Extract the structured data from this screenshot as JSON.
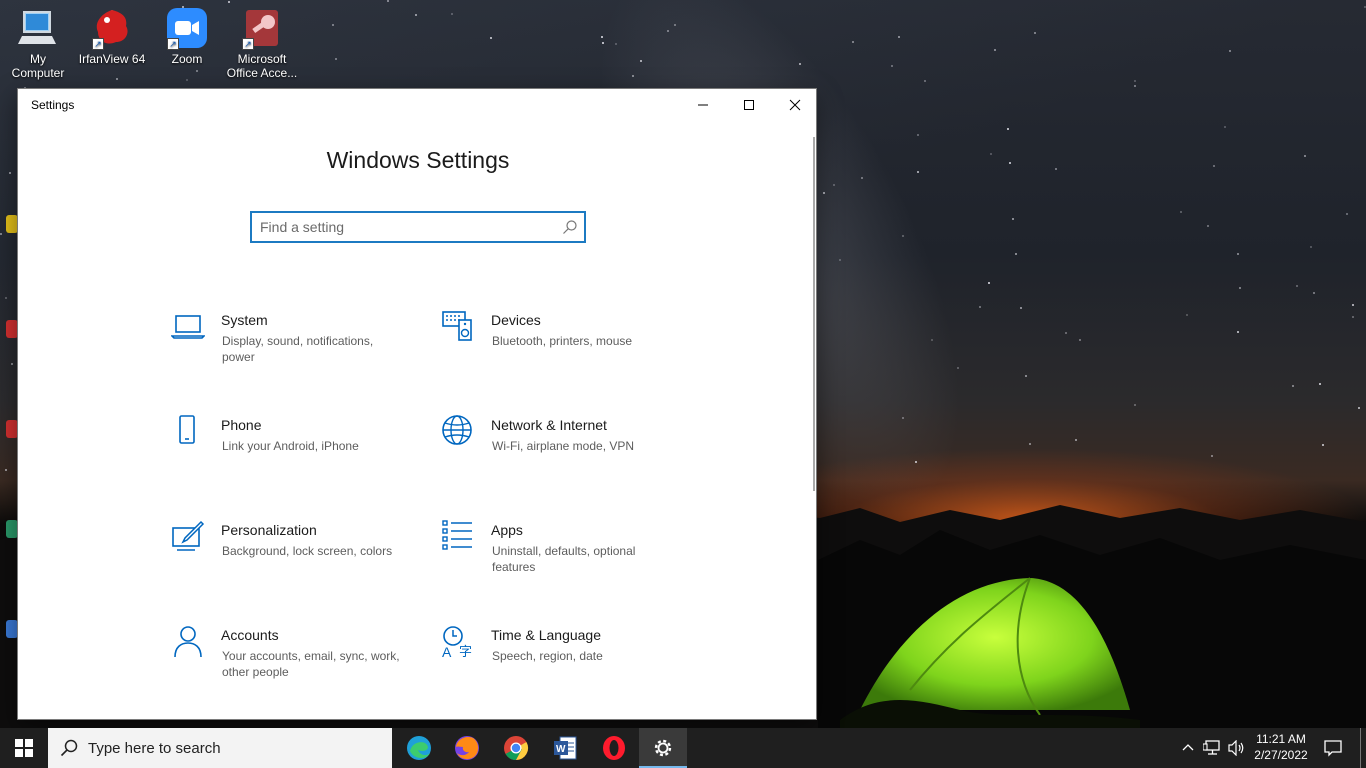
{
  "desktop": {
    "icons": [
      {
        "label_line1": "My",
        "label_line2": "Computer"
      },
      {
        "label_line1": "IrfanView 64",
        "label_line2": ""
      },
      {
        "label_line1": "Zoom",
        "label_line2": ""
      },
      {
        "label_line1": "Microsoft",
        "label_line2": "Office Acce..."
      }
    ]
  },
  "window": {
    "title": "Settings",
    "controls": {
      "minimize": "minimize-icon",
      "maximize": "maximize-icon",
      "close": "close-icon"
    },
    "heading": "Windows Settings",
    "search": {
      "placeholder": "Find a setting",
      "value": ""
    },
    "accent": "#0067c0",
    "tiles": [
      {
        "name": "System",
        "description": "Display, sound, notifications, power",
        "icon": "laptop-icon"
      },
      {
        "name": "Devices",
        "description": "Bluetooth, printers, mouse",
        "icon": "keyboard-speaker-icon"
      },
      {
        "name": "Phone",
        "description": "Link your Android, iPhone",
        "icon": "phone-icon"
      },
      {
        "name": "Network & Internet",
        "description": "Wi-Fi, airplane mode, VPN",
        "icon": "globe-icon"
      },
      {
        "name": "Personalization",
        "description": "Background, lock screen, colors",
        "icon": "paint-icon"
      },
      {
        "name": "Apps",
        "description": "Uninstall, defaults, optional features",
        "icon": "apps-list-icon"
      },
      {
        "name": "Accounts",
        "description": "Your accounts, email, sync, work, other people",
        "icon": "person-icon"
      },
      {
        "name": "Time & Language",
        "description": "Speech, region, date",
        "icon": "time-language-icon"
      }
    ]
  },
  "taskbar": {
    "search_placeholder": "Type here to search",
    "pinned_apps": [
      "edge-icon",
      "firefox-icon",
      "chrome-icon",
      "word-icon",
      "opera-icon",
      "settings-gear-icon"
    ],
    "time": "11:21 AM",
    "date": "2/27/2022"
  }
}
